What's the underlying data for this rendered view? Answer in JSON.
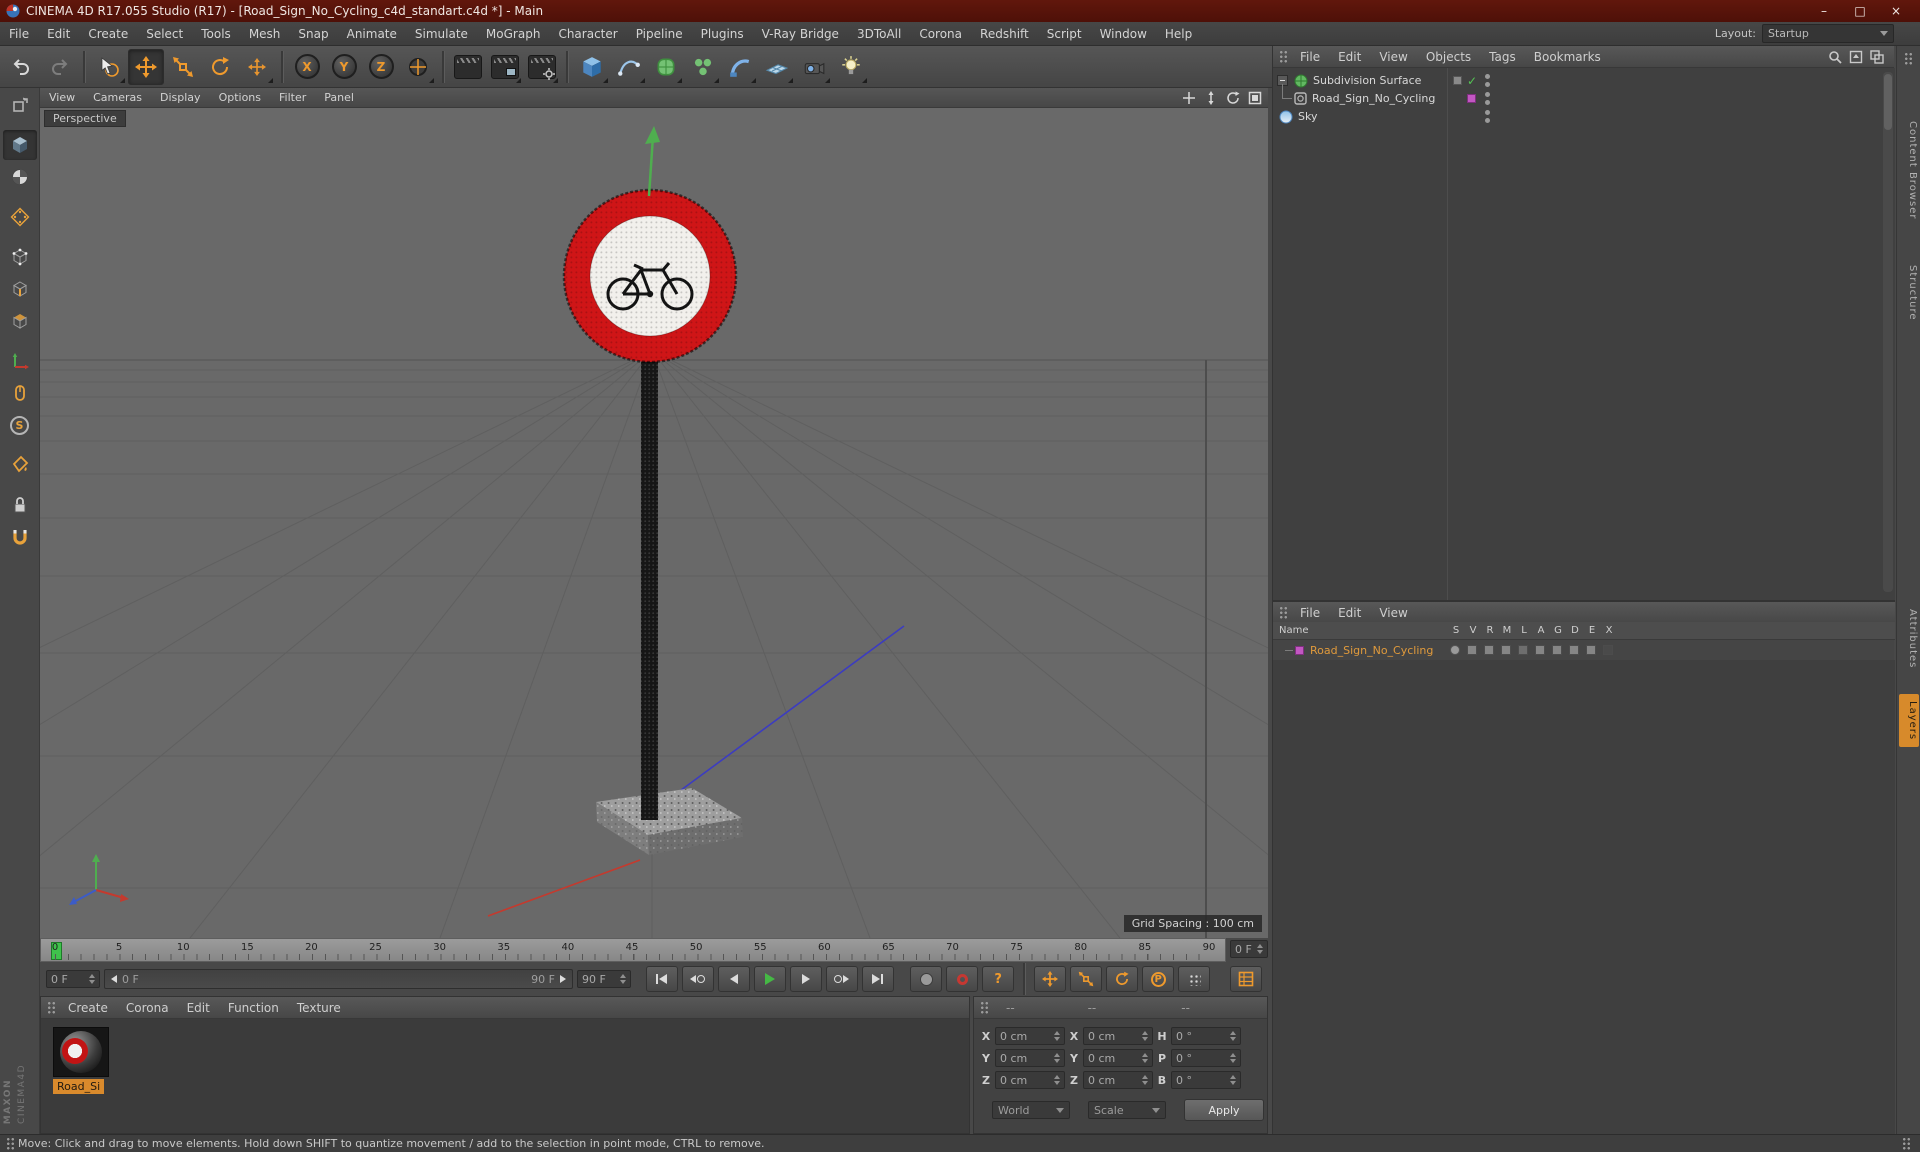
{
  "window": {
    "title": "CINEMA 4D R17.055 Studio (R17) - [Road_Sign_No_Cycling_c4d_standart.c4d *] - Main",
    "controls": {
      "minimize": "–",
      "maximize": "□",
      "close": "×"
    }
  },
  "menu_bar": {
    "items": [
      "File",
      "Edit",
      "Create",
      "Select",
      "Tools",
      "Mesh",
      "Snap",
      "Animate",
      "Simulate",
      "MoGraph",
      "Character",
      "Pipeline",
      "Plugins",
      "V-Ray Bridge",
      "3DToAll",
      "Corona",
      "Redshift",
      "Script",
      "Window",
      "Help"
    ],
    "layout_label": "Layout:",
    "layout_value": "Startup"
  },
  "toolbar": {
    "axis_x": "X",
    "axis_y": "Y",
    "axis_z": "Z"
  },
  "left_toolbar": {
    "snap_label": "S"
  },
  "viewport": {
    "menu": [
      "View",
      "Cameras",
      "Display",
      "Options",
      "Filter",
      "Panel"
    ],
    "view_label": "Perspective",
    "grid_spacing": "Grid Spacing : 100 cm"
  },
  "timeline": {
    "ticks": [
      "0",
      "5",
      "10",
      "15",
      "20",
      "25",
      "30",
      "35",
      "40",
      "45",
      "50",
      "55",
      "60",
      "65",
      "70",
      "75",
      "80",
      "85",
      "90"
    ],
    "current_frame": "0 F"
  },
  "transport": {
    "start_field": "0 F",
    "slider_current": "0 F",
    "slider_end": "90 F",
    "end_field": "90 F"
  },
  "materials": {
    "menu": [
      "Create",
      "Corona",
      "Edit",
      "Function",
      "Texture"
    ],
    "items": [
      {
        "name": "Road_Si"
      }
    ]
  },
  "coordinates": {
    "headers": [
      "--",
      "--",
      "--"
    ],
    "rows": [
      {
        "l1": "X",
        "v1": "0 cm",
        "l2": "X",
        "v2": "0 cm",
        "l3": "H",
        "v3": "0 °"
      },
      {
        "l1": "Y",
        "v1": "0 cm",
        "l2": "Y",
        "v2": "0 cm",
        "l3": "P",
        "v3": "0 °"
      },
      {
        "l1": "Z",
        "v1": "0 cm",
        "l2": "Z",
        "v2": "0 cm",
        "l3": "B",
        "v3": "0 °"
      }
    ],
    "world": "World",
    "scale": "Scale",
    "apply": "Apply"
  },
  "object_manager": {
    "menu": [
      "File",
      "Edit",
      "View",
      "Objects",
      "Tags",
      "Bookmarks"
    ],
    "objects": [
      {
        "name": "Subdivision Surface"
      },
      {
        "name": "Road_Sign_No_Cycling"
      },
      {
        "name": "Sky"
      }
    ]
  },
  "layer_manager": {
    "menu": [
      "File",
      "Edit",
      "View"
    ],
    "name_header": "Name",
    "columns": [
      "S",
      "V",
      "R",
      "M",
      "L",
      "A",
      "G",
      "D",
      "E",
      "X"
    ],
    "rows": [
      {
        "name": "Road_Sign_No_Cycling"
      }
    ]
  },
  "right_tabs": [
    {
      "label": "Content Browser"
    },
    {
      "label": "Structure"
    },
    {
      "label": "Attributes"
    },
    {
      "label": "Layers"
    }
  ],
  "status_bar": {
    "text": "Move: Click and drag to move elements. Hold down SHIFT to quantize movement / add to the selection in point mode, CTRL to remove."
  },
  "branding": {
    "maxon": "MAXON",
    "cinema": "CINEMA4D"
  },
  "colors": {
    "accent_orange": "#ef9a2d",
    "sign_red": "#cc1315",
    "layer_purple": "#c257c2",
    "play_green": "#45b945",
    "check_green": "#54c354",
    "axis_green": "#4fae4f",
    "axis_blue": "#3c3cc0",
    "axis_red": "#c43a2e",
    "title_red": "#5a140b"
  }
}
